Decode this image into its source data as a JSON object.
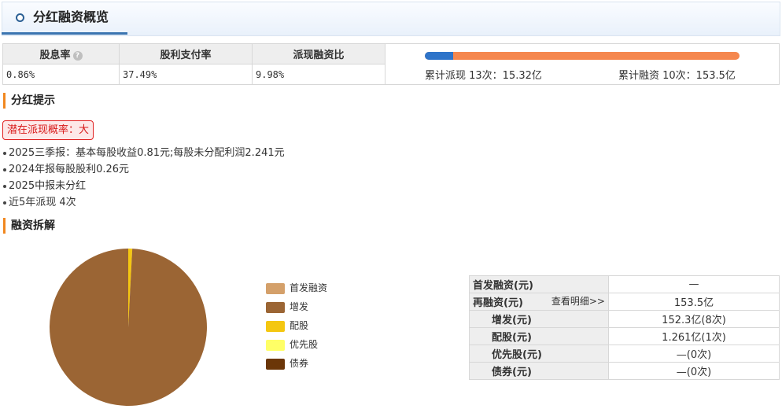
{
  "header": {
    "title": "分红融资概览"
  },
  "metrics": {
    "headers": [
      "股息率",
      "股利支付率",
      "派现融资比"
    ],
    "values": [
      "0.86%",
      "37.49%",
      "9.98%"
    ],
    "help_icon": "?",
    "bar": {
      "payout_fraction": 0.0907,
      "payout_label": "累计派现 13次：15.32亿",
      "financing_label": "累计融资 10次：153.5亿",
      "payout_color": "#2e74c9",
      "financing_color": "#f5874e"
    }
  },
  "dividend": {
    "title": "分红提示",
    "tag": "潜在派现概率：大",
    "notes": [
      "2025三季报：基本每股收益0.81元;每股未分配利润2.241元",
      "2024年报每股股利0.26元",
      "2025中报未分红",
      "近5年派现 4次"
    ]
  },
  "financing": {
    "title": "融资拆解",
    "legend": [
      {
        "label": "首发融资",
        "color": "#d4a06a"
      },
      {
        "label": "增发",
        "color": "#9b6534"
      },
      {
        "label": "配股",
        "color": "#f4c711"
      },
      {
        "label": "优先股",
        "color": "#ffff66"
      },
      {
        "label": "债券",
        "color": "#6b3608"
      }
    ],
    "pie": [
      {
        "label": "增发",
        "value": 152.3
      },
      {
        "label": "配股",
        "value": 1.261
      }
    ],
    "table": [
      {
        "key": "首发融资(元)",
        "value": "—"
      },
      {
        "key": "再融资(元)",
        "value": "153.5亿",
        "link": "查看明细>>"
      },
      {
        "key": "增发(元)",
        "value": "152.3亿(8次)"
      },
      {
        "key": "配股(元)",
        "value": "1.261亿(1次)"
      },
      {
        "key": "优先股(元)",
        "value": "—(0次)"
      },
      {
        "key": "债券(元)",
        "value": "—(0次)"
      }
    ]
  }
}
